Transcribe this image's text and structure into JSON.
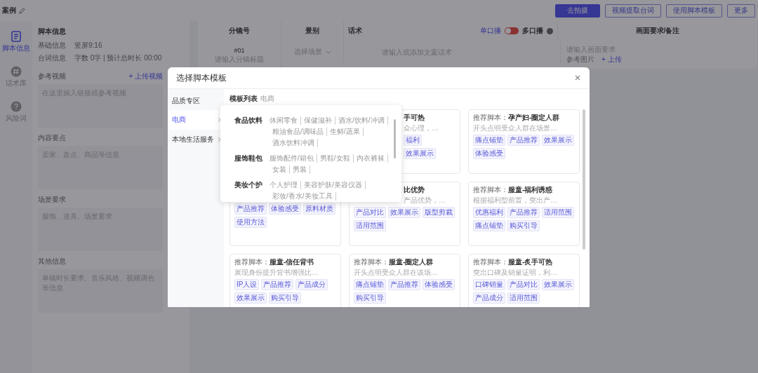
{
  "header": {
    "title": "案例",
    "buttons": [
      {
        "label": "去拍摄",
        "kind": "primary"
      },
      {
        "label": "视频提取台词",
        "kind": "outline"
      },
      {
        "label": "使用脚本模板",
        "kind": "outline"
      },
      {
        "label": "更多",
        "kind": "outline"
      }
    ]
  },
  "rail": [
    {
      "label": "脚本信息",
      "selected": true
    },
    {
      "label": "话术库",
      "selected": false
    },
    {
      "label": "风险词",
      "selected": false
    }
  ],
  "script_info": {
    "title": "脚本信息",
    "rows": [
      {
        "label": "基础信息",
        "value": "竖屏9:16"
      },
      {
        "label": "台词信息",
        "value": "字数 0字 | 预计总时长 00:00"
      }
    ],
    "fields": [
      {
        "label": "参考视频",
        "action": "+ 上传视频",
        "placeholder": "在这里插入链接或参考视频"
      },
      {
        "label": "内容要点",
        "placeholder": "卖家、盘点、商品等信息"
      },
      {
        "label": "场景要求",
        "placeholder": "服饰、道具、场景要求"
      },
      {
        "label": "其他信息",
        "placeholder": "单镜时长要求、音乐风格、视频调色等信息"
      }
    ]
  },
  "storyboard": {
    "columns": [
      "分镜号",
      "景别",
      "话术",
      "画面要求/备注"
    ],
    "mode_single": "单口播",
    "mode_multi": "多口播",
    "toggle_on": false,
    "row": {
      "number": "#01",
      "title_placeholder": "请输入分镜标题",
      "shot_placeholder": "选择场景",
      "script_placeholder": "请输入或添加文案话术",
      "req_placeholder": "请输入画面要求",
      "ref_label": "参考图片",
      "upload": "+ 上传"
    }
  },
  "modal": {
    "title": "选择脚本模板",
    "nav_header": "品质专区",
    "nav": [
      {
        "label": "电商",
        "selected": true
      },
      {
        "label": "本地生活服务",
        "selected": false
      }
    ],
    "list_title": "模板列表",
    "list_crumb": "电商",
    "popover": [
      {
        "name": "食品饮料",
        "items": [
          "休闲零食",
          "保健滋补",
          "酒水/饮料/冲调",
          "粮油食品/调味品",
          "生鲜/蔬果",
          "酒水饮料冲调"
        ]
      },
      {
        "name": "服饰鞋包",
        "items": [
          "服饰配件/箱包",
          "男鞋/女鞋",
          "内衣裤袜",
          "女装",
          "男装"
        ]
      },
      {
        "name": "美妆个护",
        "items": [
          "个人护理",
          "美容护肤/美容仪器",
          "彩妆/香水/美妆工具"
        ]
      }
    ],
    "cards": [
      {
        "kind": "hidden"
      },
      {
        "kind": "right_part",
        "title": "手可热",
        "desc": "众心理，…",
        "tags": [
          "福利",
          "效果展示"
        ]
      },
      {
        "kind": "full",
        "prefix": "推荐脚本：",
        "title": "孕产妇-圈定人群",
        "desc": "开头点明受众人群在场景…",
        "tags": [
          "痛点铺垫",
          "产品推荐",
          "效果展示",
          "体验感受"
        ]
      },
      {
        "kind": "lower_part",
        "tags": [
          "产品推荐",
          "体验感受",
          "原料材质",
          "使用方法"
        ]
      },
      {
        "kind": "right_top",
        "title": "比优势",
        "desc": "产品优势，…",
        "tags": [
          "产品对比",
          "效果展示",
          "版型剪裁",
          "适用范围"
        ]
      },
      {
        "kind": "full",
        "prefix": "推荐脚本：",
        "title": "服童-福利诱惑",
        "desc": "根据福利型前置，突出产…",
        "tags": [
          "优惠福利",
          "产品推荐",
          "适用范围",
          "痛点铺垫",
          "购买引导"
        ]
      },
      {
        "kind": "full",
        "prefix": "推荐脚本：",
        "title": "服童-信任背书",
        "desc": "展现身份提升背书增强比…",
        "tags": [
          "IP人设",
          "产品推荐",
          "产品成分",
          "效果展示",
          "购买引导"
        ]
      },
      {
        "kind": "full",
        "prefix": "推荐脚本：",
        "title": "服童-圈定人群",
        "desc": "开头点明受众人群在该场…",
        "tags": [
          "痛点铺垫",
          "产品推荐",
          "体验感受",
          "购买引导"
        ]
      },
      {
        "kind": "full",
        "prefix": "推荐脚本：",
        "title": "服童-炙手可热",
        "desc": "突出口碑及销量证明，利…",
        "tags": [
          "口碑销量",
          "产品对比",
          "效果展示",
          "产品成分",
          "适用范围"
        ]
      }
    ]
  }
}
